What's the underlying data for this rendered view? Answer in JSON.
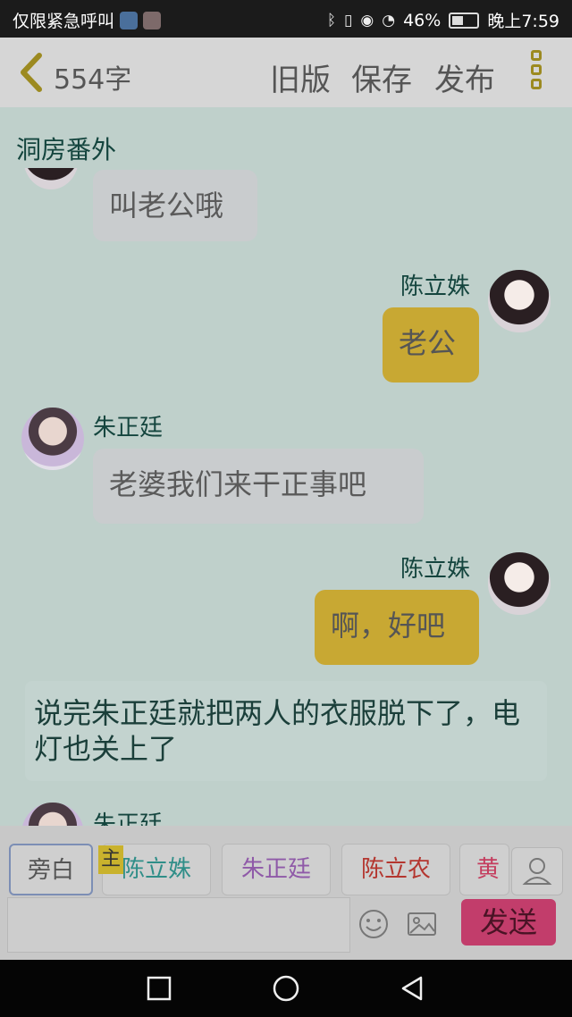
{
  "status": {
    "carrier": "仅限紧急呼叫",
    "battery": "46%",
    "time": "晚上7:59"
  },
  "header": {
    "word_count": "554字",
    "actions": [
      "旧版",
      "保存",
      "发布"
    ]
  },
  "chat": {
    "title": "洞房番外",
    "messages": [
      {
        "speaker": "",
        "side": "left",
        "text": "叫老公哦"
      },
      {
        "speaker": "陈立姝",
        "side": "right",
        "text": "老公"
      },
      {
        "speaker": "朱正廷",
        "side": "left",
        "text": "老婆我们来干正事吧"
      },
      {
        "speaker": "陈立姝",
        "side": "right",
        "text": "啊，好吧"
      }
    ],
    "narration": "说完朱正廷就把两人的衣服脱下了，电灯也关上了",
    "partial_speaker": "朱正廷"
  },
  "roles": {
    "tag": "主",
    "items": [
      "旁白",
      "陈立姝",
      "朱正廷",
      "陈立农",
      "黄"
    ],
    "colors": [
      "#555555",
      "#2f8e88",
      "#8f5aa8",
      "#b4362f",
      "#c43d5e"
    ]
  },
  "composer": {
    "placeholder": "",
    "send_label": "发送"
  },
  "colors": {
    "accent_yellow": "#c8a833",
    "send_pink": "#c23d6b"
  }
}
